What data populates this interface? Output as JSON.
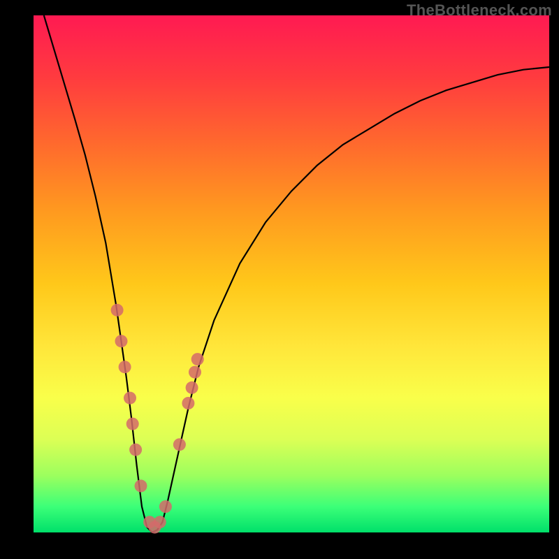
{
  "watermark": "TheBottleneck.com",
  "colors": {
    "frame": "#000000",
    "curve": "#000000",
    "markers": "#d46a6a",
    "gradient_top": "#ff1a52",
    "gradient_bottom": "#00e06a"
  },
  "chart_data": {
    "type": "line",
    "title": "",
    "xlabel": "",
    "ylabel": "",
    "xlim": [
      0,
      100
    ],
    "ylim": [
      0,
      100
    ],
    "series": [
      {
        "name": "bottleneck_curve",
        "x": [
          2,
          5,
          8,
          10,
          12,
          14,
          15,
          16,
          17,
          18,
          19,
          20,
          21,
          22,
          23,
          24,
          25,
          26,
          28,
          30,
          32,
          35,
          40,
          45,
          50,
          55,
          60,
          65,
          70,
          75,
          80,
          85,
          90,
          95,
          100
        ],
        "y": [
          100,
          90,
          80,
          73,
          65,
          56,
          50,
          44,
          37,
          30,
          22,
          13,
          5,
          1,
          0,
          0.5,
          2,
          6,
          15,
          24,
          32,
          41,
          52,
          60,
          66,
          71,
          75,
          78,
          81,
          83.5,
          85.5,
          87,
          88.5,
          89.5,
          90
        ]
      }
    ],
    "markers": {
      "name": "highlight_points",
      "x": [
        16.2,
        17.0,
        17.7,
        18.7,
        19.2,
        19.8,
        20.8,
        22.5,
        23.5,
        24.5,
        25.6,
        28.3,
        30.0,
        30.7,
        31.3,
        31.8
      ],
      "y": [
        43,
        37,
        32,
        26,
        21,
        16,
        9,
        2,
        1,
        2,
        5,
        17,
        25,
        28,
        31,
        33.5
      ]
    }
  }
}
